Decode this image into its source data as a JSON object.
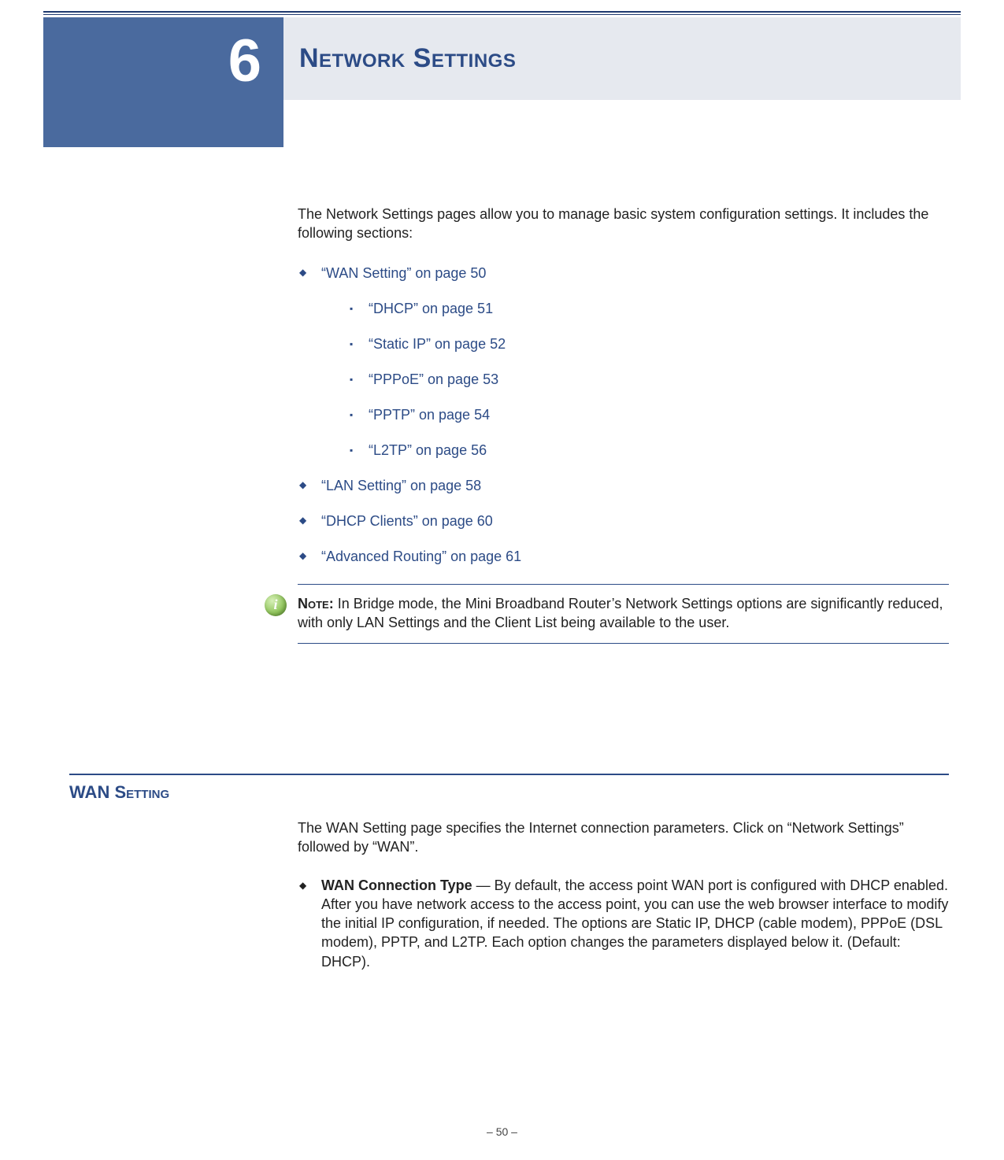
{
  "chapter": {
    "number": "6",
    "title": "Network Settings"
  },
  "intro": "The Network Settings pages allow you to manage basic system configuration settings. It includes the following sections:",
  "links": {
    "wan_setting": "“WAN Setting” on page 50",
    "dhcp": "“DHCP” on page 51",
    "static_ip": "“Static IP” on page 52",
    "pppoe": "“PPPoE” on page 53",
    "pptp": "“PPTP” on page 54",
    "l2tp": "“L2TP” on page 56",
    "lan_setting": "“LAN Setting” on page 58",
    "dhcp_clients": "“DHCP Clients” on page 60",
    "advanced_routing": "“Advanced Routing” on page 61"
  },
  "note": {
    "label": "Note:",
    "text": " In Bridge mode, the Mini Broadband Router’s Network Settings options are significantly reduced, with only LAN Settings and the Client List being available to the user."
  },
  "wan_section": {
    "heading": "WAN Setting",
    "intro": "The WAN Setting page specifies the Internet connection parameters. Click on “Network Settings” followed by “WAN”.",
    "item_term": "WAN Connection Type",
    "item_text": " — By default, the access point WAN port is configured with DHCP enabled. After you have network access to the access point, you can use the web browser interface to modify the initial IP configuration, if needed. The options are Static IP, DHCP (cable modem), PPPoE (DSL modem), PPTP, and L2TP. Each option changes the parameters displayed below it. (Default: DHCP)."
  },
  "footer": "–  50  –"
}
